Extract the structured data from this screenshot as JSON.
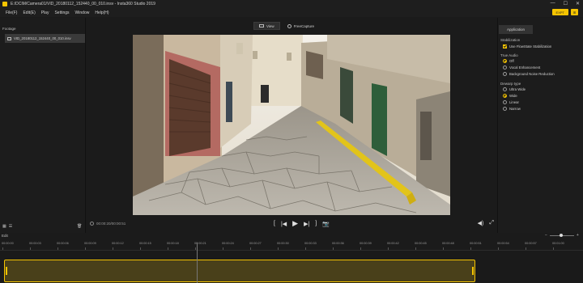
{
  "window": {
    "title": "E:/DCIM/Camera01/VID_20180112_152440_00_010.insv - Insta360 Studio 2019",
    "minimize_glyph": "—",
    "maximize_glyph": "☐",
    "close_glyph": "✕"
  },
  "menu": [
    "File(F)",
    "Edit(E)",
    "Play",
    "Settings",
    "Window",
    "Help(H)"
  ],
  "top_buttons": {
    "export_label": "EXPT",
    "extra_label": "⊞"
  },
  "footage": {
    "title": "Footage",
    "items": [
      {
        "label": "VID_20180112_152440_00_010.insv"
      }
    ]
  },
  "left_bottom": {
    "grid_glyph": "▦",
    "list_glyph": "☰",
    "trash_glyph": "🗑"
  },
  "view_tabs": [
    {
      "label": "View",
      "active": true
    },
    {
      "label": "FreeCapture",
      "active": false
    }
  ],
  "playback": {
    "timecode": "00:00:20/00:00:51",
    "controls": {
      "mark_in": "[",
      "prev": "|◀",
      "play": "▶",
      "next": "▶|",
      "mark_out": "]",
      "snapshot": "📷"
    },
    "volume_glyph": "◀)",
    "fullscreen_glyph": "⤢"
  },
  "right_panel": {
    "tab": "Application",
    "stabilization": {
      "title": "Stabilization",
      "flowstate_label": "Use FlowState Stabilization",
      "flowstate_checked": true
    },
    "true_audio": {
      "title": "True Audio",
      "options": [
        {
          "label": "Off",
          "selected": true
        },
        {
          "label": "Vocal Enhancement",
          "selected": false
        },
        {
          "label": "Background Noise Reduction",
          "selected": false
        }
      ]
    },
    "dewarp": {
      "title": "Dewarp type",
      "options": [
        {
          "label": "Ultra Wide",
          "selected": false
        },
        {
          "label": "Wide",
          "selected": true
        },
        {
          "label": "Linear",
          "selected": false
        },
        {
          "label": "Narrow",
          "selected": false
        }
      ]
    }
  },
  "timeline": {
    "edit_label": "Edit",
    "zoom_minus": "−",
    "zoom_plus": "+",
    "zoom_level": 0.4,
    "ticks": [
      "00:00:00",
      "00:00:03",
      "00:00:06",
      "00:00:09",
      "00:00:12",
      "00:00:15",
      "00:00:18",
      "00:00:21",
      "00:00:24",
      "00:00:27",
      "00:00:30",
      "00:00:33",
      "00:00:36",
      "00:00:39",
      "00:00:42",
      "00:00:45",
      "00:00:48",
      "00:00:51",
      "00:00:54",
      "00:00:57",
      "00:01:00",
      "00:01:03",
      "00:01:06"
    ]
  },
  "colors": {
    "accent": "#f5c400",
    "background": "#1b1b1b",
    "clip_fill": "#49401a"
  }
}
